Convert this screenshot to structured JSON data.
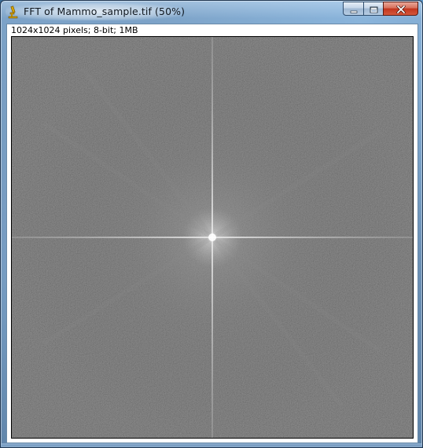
{
  "window": {
    "title": "FFT of Mammo_sample.tif (50%)",
    "controls": {
      "minimize": "minimize-icon",
      "maximize": "maximize-icon",
      "close": "close-icon"
    }
  },
  "image": {
    "info": "1024x1024 pixels; 8-bit; 1MB",
    "content": "fft-power-spectrum"
  },
  "colors": {
    "background_gray": "#555555",
    "cross_highlight": "#bdbdbd",
    "close_button": "#c2351d"
  }
}
